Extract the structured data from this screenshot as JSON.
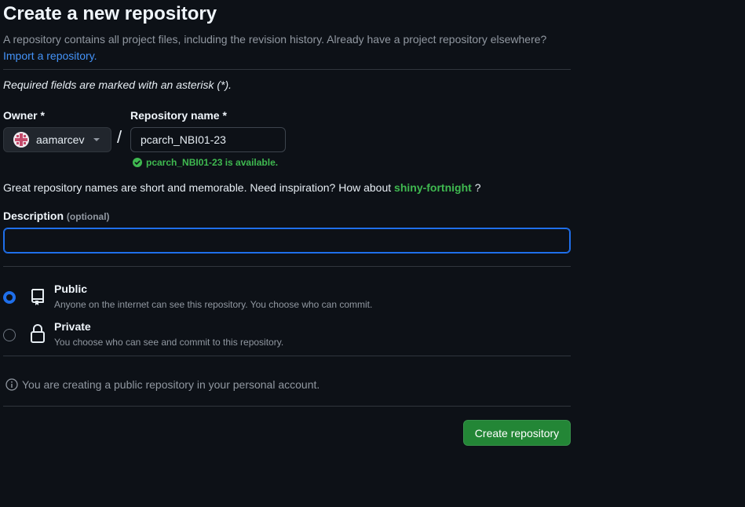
{
  "page": {
    "title": "Create a new repository",
    "intro_text": "A repository contains all project files, including the revision history. Already have a project repository elsewhere?",
    "import_link": "Import a repository.",
    "required_note": "Required fields are marked with an asterisk (*)."
  },
  "owner": {
    "label": "Owner *",
    "selected": "aamarcev",
    "icon": "avatar-icon"
  },
  "separator": "/",
  "repo_name": {
    "label": "Repository name *",
    "value": "pcarch_NBI01-23",
    "availability": "pcarch_NBI01-23 is available.",
    "availability_color": "#3fb950"
  },
  "suggestion": {
    "text": "Great repository names are short and memorable. Need inspiration? How about",
    "name": "shiny-fortnight",
    "suffix": "?"
  },
  "description": {
    "label": "Description",
    "optional": "(optional)",
    "value": ""
  },
  "visibility": {
    "options": [
      {
        "title": "Public",
        "desc": "Anyone on the internet can see this repository. You choose who can commit.",
        "checked": true,
        "icon": "repo-icon"
      },
      {
        "title": "Private",
        "desc": "You choose who can see and commit to this repository.",
        "checked": false,
        "icon": "lock-icon"
      }
    ]
  },
  "info_text": "You are creating a public repository in your personal account.",
  "submit_label": "Create repository",
  "colors": {
    "background": "#0d1117",
    "accent_blue": "#1f6feb",
    "button_green": "#238636",
    "link": "#4493f8"
  }
}
